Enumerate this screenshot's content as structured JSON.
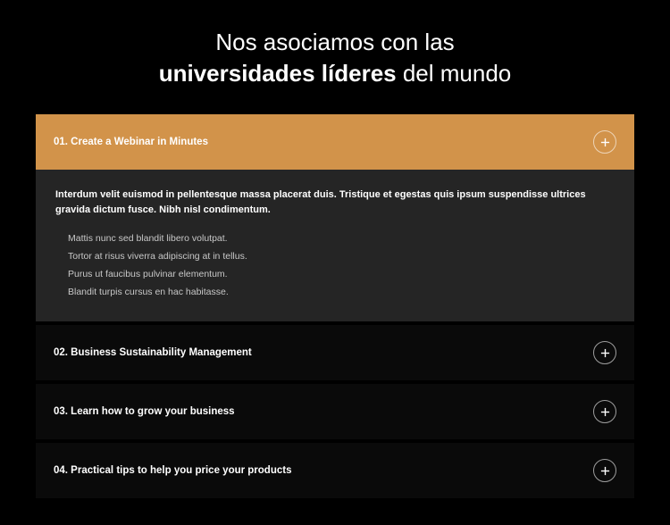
{
  "heading": {
    "line1_prefix": "Nos asociamos con las",
    "line2_bold": "universidades líderes",
    "line2_suffix": " del mundo"
  },
  "accordion": {
    "items": [
      {
        "title": "01. Create a Webinar in Minutes",
        "expanded": true,
        "content": {
          "intro": "Interdum velit euismod in pellentesque massa placerat duis. Tristique et egestas quis ipsum suspendisse ultrices gravida dictum fusce. Nibh nisl condimentum.",
          "bullets": [
            "Mattis nunc sed blandit libero volutpat.",
            "Tortor at risus viverra adipiscing at in tellus.",
            "Purus ut faucibus pulvinar elementum.",
            "Blandit turpis cursus en hac habitasse."
          ]
        }
      },
      {
        "title": "02. Business Sustainability Management",
        "expanded": false
      },
      {
        "title": "03. Learn how to grow your business",
        "expanded": false
      },
      {
        "title": "04. Practical tips to help you price your products",
        "expanded": false
      }
    ]
  },
  "colors": {
    "accent": "#d2934a",
    "background": "#000000",
    "panel": "#252525"
  }
}
